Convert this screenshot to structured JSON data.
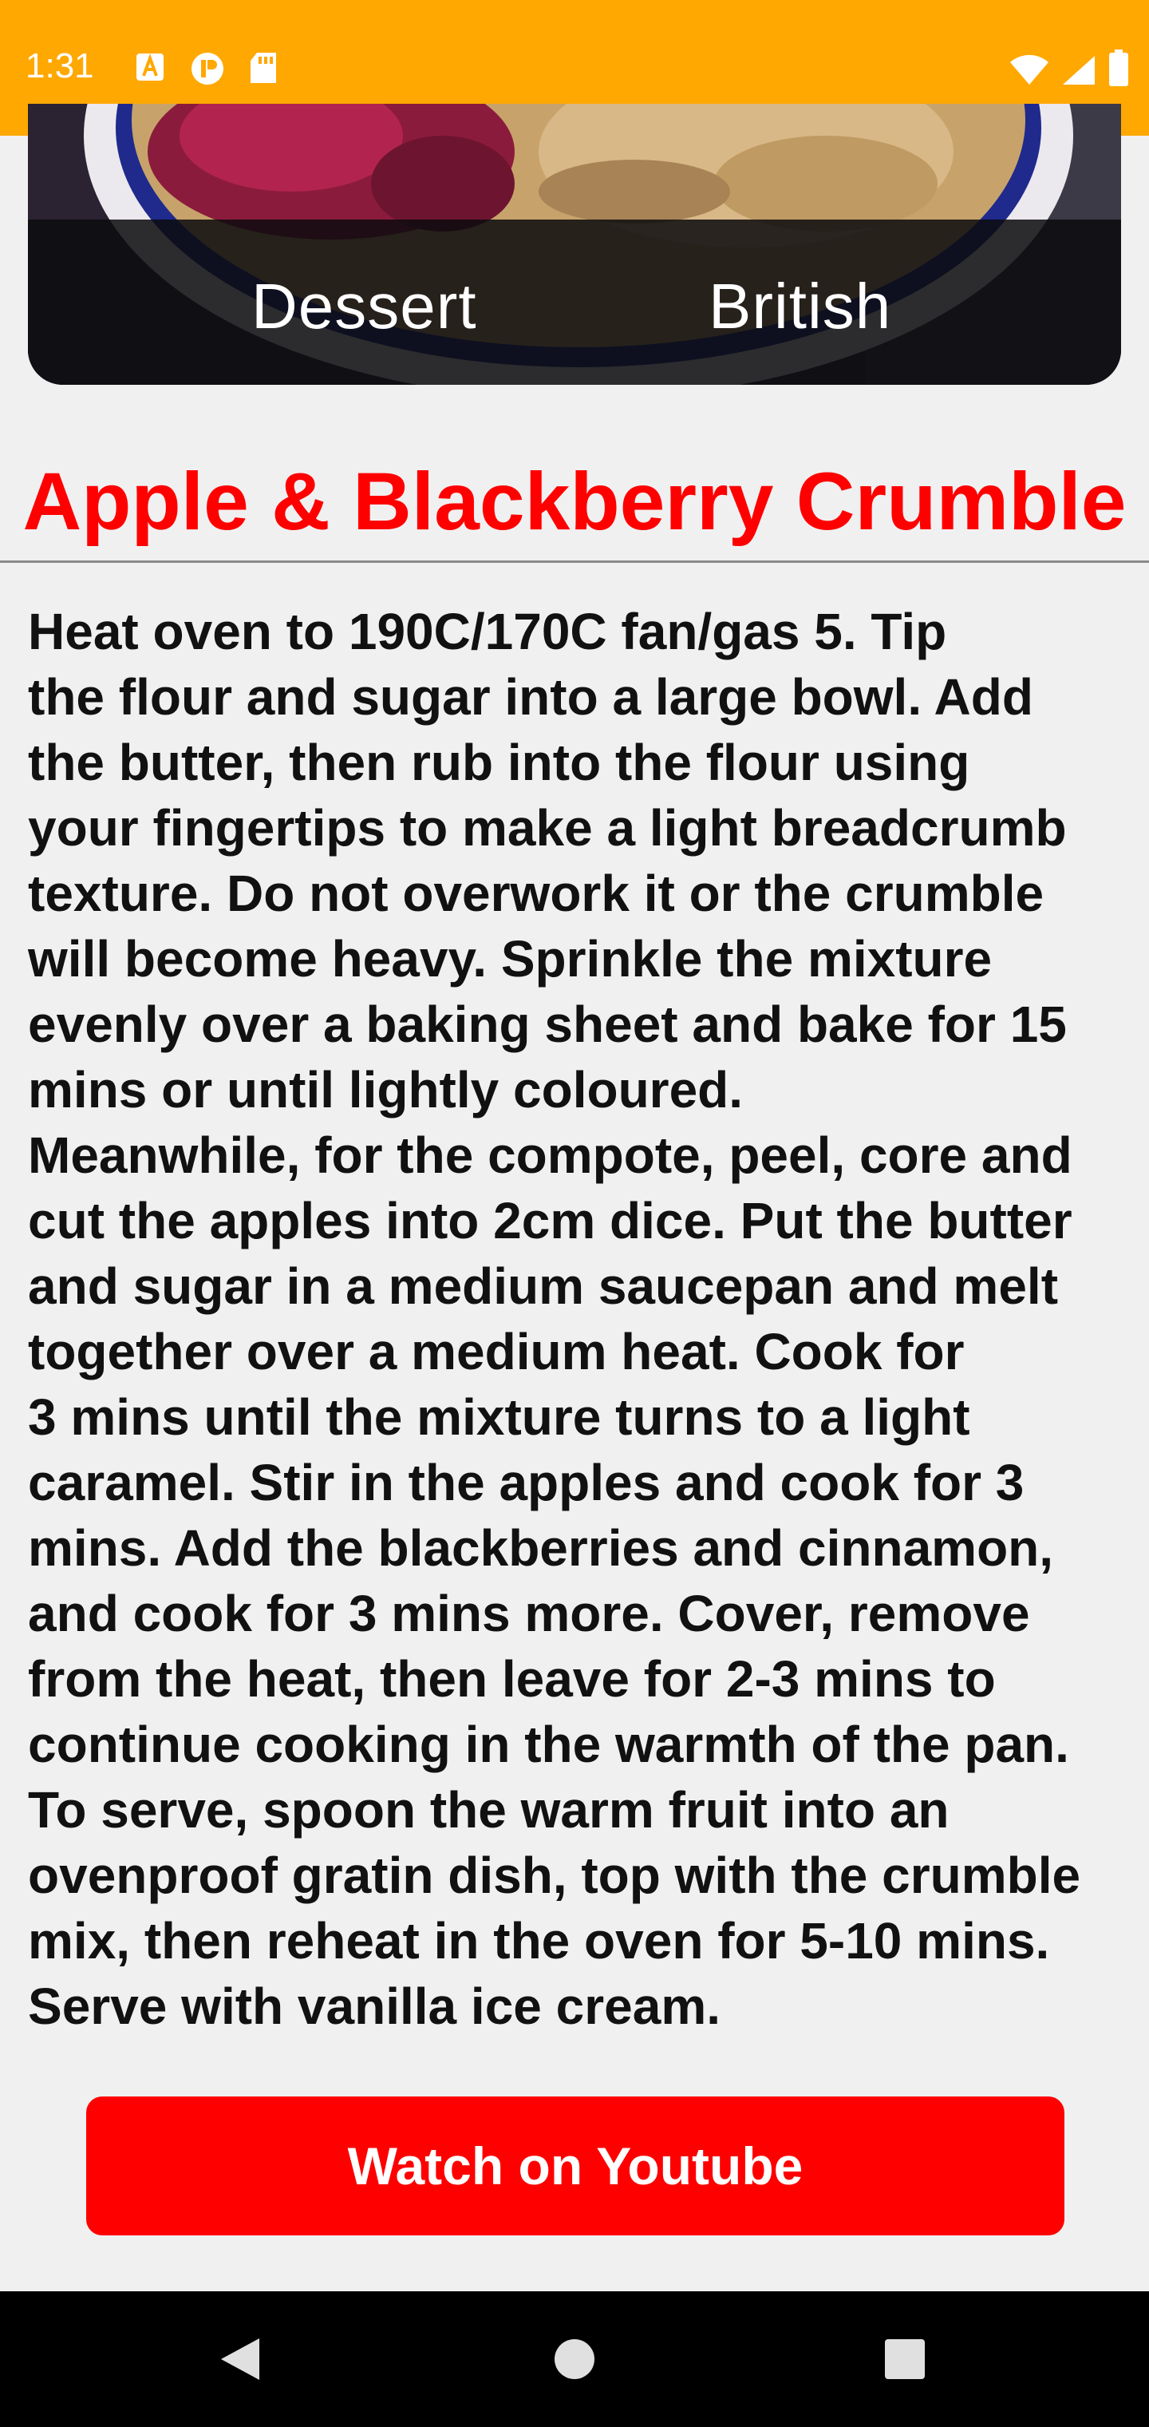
{
  "status_bar": {
    "time": "1:31",
    "left_icons": [
      "a-icon",
      "p-icon",
      "sd-card-icon"
    ],
    "right_icons": [
      "wifi-icon",
      "signal-icon",
      "battery-icon"
    ],
    "color": "#ffa801"
  },
  "hero": {
    "category": "Dessert",
    "area": "British"
  },
  "recipe": {
    "title": "Apple & Blackberry Crumble",
    "instructions": "Heat oven to 190C/170C fan/gas 5. Tip\nthe flour and sugar into a large bowl. Add\nthe butter, then rub into the flour using\nyour fingertips to make a light breadcrumb\ntexture. Do not overwork it or the crumble\nwill become heavy. Sprinkle the mixture\nevenly over a baking sheet and bake for 15\nmins or until lightly coloured.\nMeanwhile, for the compote, peel, core and\ncut the apples into 2cm dice. Put the butter\nand sugar in a medium saucepan and melt\ntogether over a medium heat. Cook for\n3 mins until the mixture turns to a light\ncaramel. Stir in the apples and cook for 3\nmins. Add the blackberries and cinnamon,\nand cook for 3 mins more. Cover, remove\nfrom the heat, then leave for 2-3 mins to\ncontinue cooking in the warmth of the pan.\nTo serve, spoon the warm fruit into an\novenproof gratin dish, top with the crumble\nmix, then reheat in the oven for 5-10 mins.\nServe with vanilla ice cream."
  },
  "actions": {
    "youtube_label": "Watch on Youtube"
  },
  "colors": {
    "accent": "#fe0000",
    "background": "#f1f0f1"
  },
  "nav_bar": {
    "buttons": [
      "back-icon",
      "home-icon",
      "recents-icon"
    ]
  }
}
